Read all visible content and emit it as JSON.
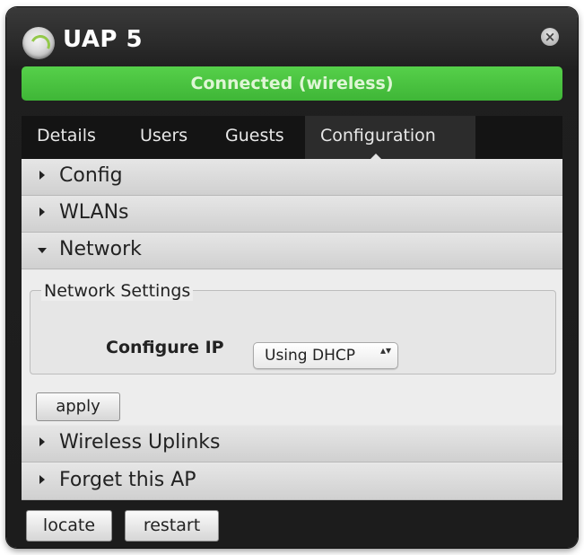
{
  "window": {
    "title": "UAP 5",
    "close_glyph": "×",
    "status": "Connected (wireless)",
    "status_color": "#4cc43f"
  },
  "tabs": [
    {
      "label": "Details",
      "active": false
    },
    {
      "label": "Users",
      "active": false
    },
    {
      "label": "Guests",
      "active": false
    },
    {
      "label": "Configuration",
      "active": true
    }
  ],
  "sections": {
    "config": {
      "label": "Config",
      "expanded": false
    },
    "wlans": {
      "label": "WLANs",
      "expanded": false
    },
    "network": {
      "label": "Network",
      "expanded": true
    },
    "wireless_uplinks": {
      "label": "Wireless Uplinks",
      "expanded": false
    },
    "forget": {
      "label": "Forget this AP",
      "expanded": false
    }
  },
  "network_settings": {
    "legend": "Network Settings",
    "configure_ip_label": "Configure IP",
    "configure_ip_value": "Using DHCP",
    "select_arrows": "▴▾",
    "apply_label": "apply"
  },
  "footer": {
    "locate_label": "locate",
    "restart_label": "restart"
  },
  "icons": {
    "logo": "ubiquiti-logo-icon",
    "close": "close-icon",
    "collapsed": "triangle-right-icon",
    "expanded": "triangle-down-icon"
  }
}
